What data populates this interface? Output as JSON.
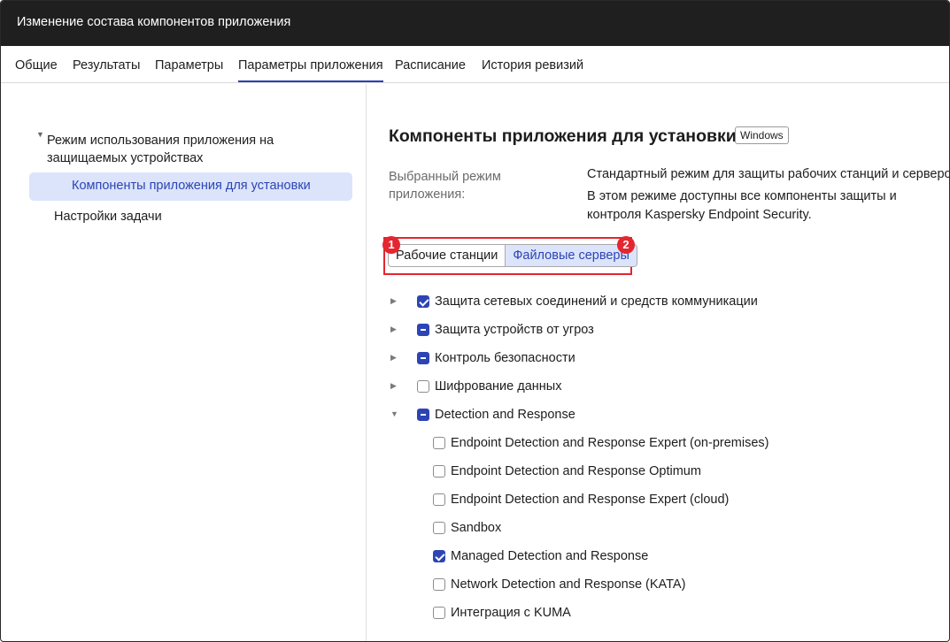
{
  "window": {
    "title": "Изменение состава компонентов приложения"
  },
  "tabs": [
    {
      "label": "Общие"
    },
    {
      "label": "Результаты"
    },
    {
      "label": "Параметры"
    },
    {
      "label": "Параметры приложения",
      "active": true
    },
    {
      "label": "Расписание"
    },
    {
      "label": "История ревизий"
    }
  ],
  "sidebar": {
    "parent": {
      "label": "Режим использования приложения на защищаемых устройствах",
      "expanded": true
    },
    "selected": {
      "label": "Компоненты приложения для установки"
    },
    "other": {
      "label": "Настройки задачи"
    }
  },
  "content": {
    "title": "Компоненты приложения для установки",
    "os_badge": "Windows",
    "mode_label": "Выбранный режим приложения:",
    "mode_value": "Стандартный режим для защиты рабочих станций и серверов",
    "mode_description": "В этом режиме доступны все компоненты защиты и контроля Kaspersky Endpoint Security.",
    "segments": [
      {
        "label": "Рабочие станции",
        "selected": false
      },
      {
        "label": "Файловые серверы",
        "selected": true
      }
    ],
    "markers": [
      "1",
      "2"
    ],
    "components": [
      {
        "label": "Защита сетевых соединений и средств коммуникации",
        "state": "checked",
        "expandable": true,
        "expanded": false
      },
      {
        "label": "Защита устройств от угроз",
        "state": "partial",
        "expandable": true,
        "expanded": false
      },
      {
        "label": "Контроль безопасности",
        "state": "partial",
        "expandable": true,
        "expanded": false
      },
      {
        "label": "Шифрование данных",
        "state": "unchecked",
        "expandable": true,
        "expanded": false
      },
      {
        "label": "Detection and Response",
        "state": "partial",
        "expandable": true,
        "expanded": true,
        "children": [
          {
            "label": "Endpoint Detection and Response Expert (on-premises)",
            "state": "unchecked"
          },
          {
            "label": "Endpoint Detection and Response Optimum",
            "state": "unchecked"
          },
          {
            "label": "Endpoint Detection and Response Expert (cloud)",
            "state": "unchecked"
          },
          {
            "label": "Sandbox",
            "state": "unchecked"
          },
          {
            "label": "Managed Detection and Response",
            "state": "checked"
          },
          {
            "label": "Network Detection and Response (KATA)",
            "state": "unchecked"
          },
          {
            "label": "Интеграция с KUMA",
            "state": "unchecked"
          }
        ]
      }
    ]
  },
  "colors": {
    "accent": "#2d44b5",
    "highlight": "#e3262f",
    "selected_bg": "#dbe4fa",
    "titlebar": "#1f1f1f"
  },
  "icons": {
    "expand_collapsed": "triangle-right-icon",
    "expand_expanded": "triangle-down-icon",
    "tree_expanded": "triangle-down-icon"
  }
}
